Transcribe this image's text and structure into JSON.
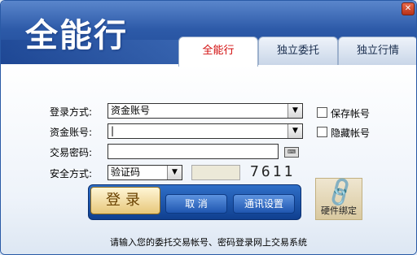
{
  "header": {
    "title": "全能行",
    "close_icon": "✕"
  },
  "tabs": [
    {
      "label": "全能行",
      "active": true
    },
    {
      "label": "独立委托",
      "active": false
    },
    {
      "label": "独立行情",
      "active": false
    }
  ],
  "form": {
    "login_mode_label": "登录方式:",
    "login_mode_value": "资金账号",
    "account_label": "资金账号:",
    "account_value": "|",
    "password_label": "交易密码:",
    "password_value": "",
    "security_label": "安全方式:",
    "security_value": "验证码",
    "captcha_input": "",
    "captcha_text": "7611",
    "save_account_label": "保存帐号",
    "hide_account_label": "隐藏帐号"
  },
  "buttons": {
    "login": "登录",
    "cancel": "取 消",
    "comm_settings": "通讯设置",
    "hardware_bind": "硬件绑定"
  },
  "status": "请输入您的委托交易帐号、密码登录网上交易系统",
  "colors": {
    "banner": "#2d5aa8",
    "active_tab_text": "#d20b0b"
  }
}
